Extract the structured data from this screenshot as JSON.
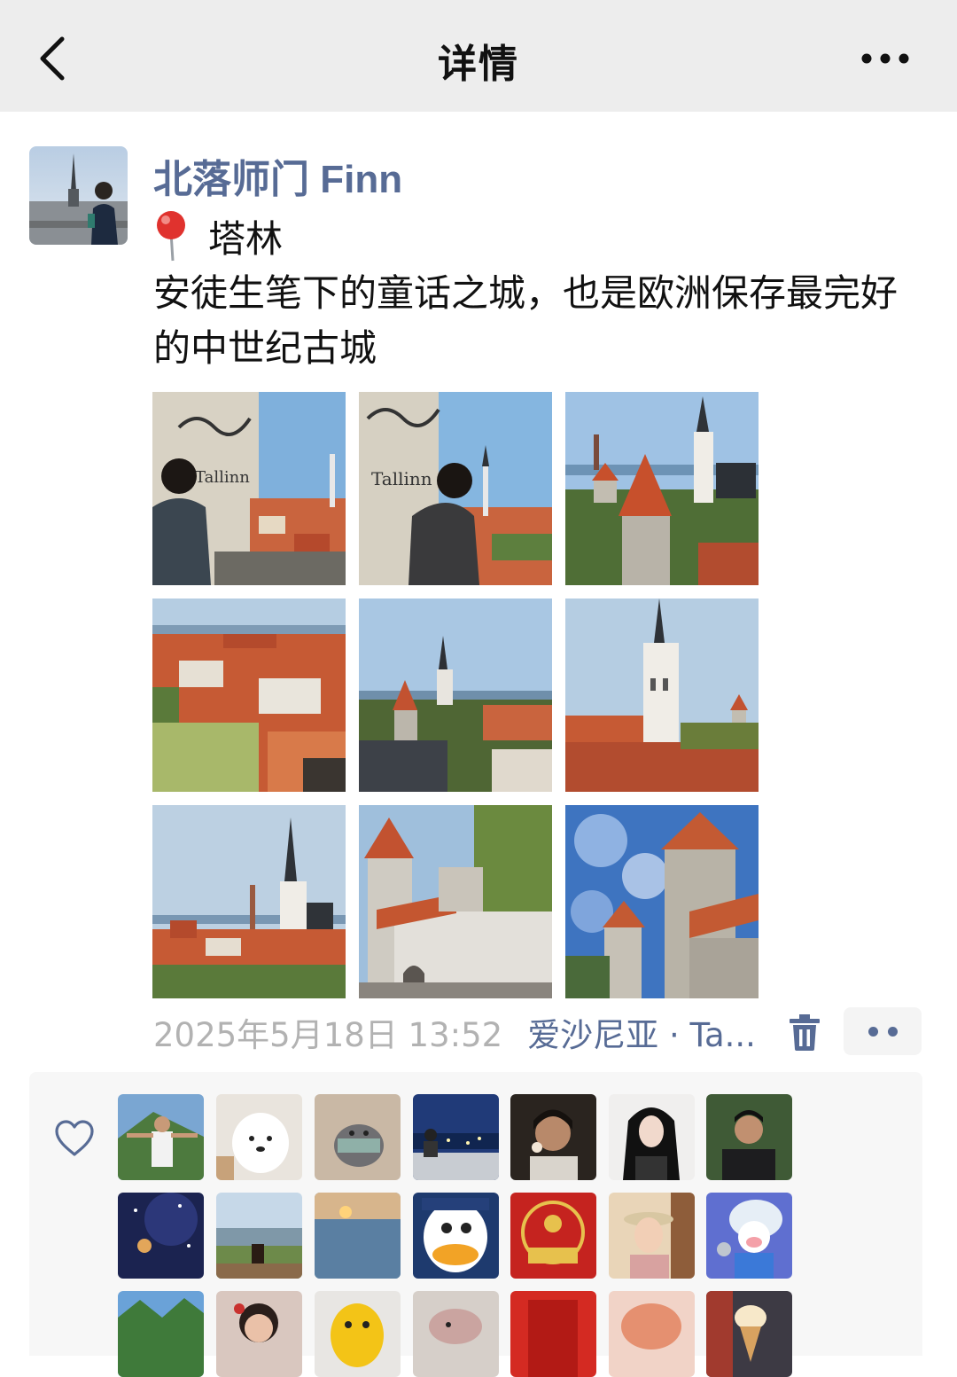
{
  "nav": {
    "title": "详情",
    "back_icon": "chevron-left-icon",
    "more_icon": "more-horizontal-icon"
  },
  "post": {
    "author": "北落师门 Finn",
    "location_icon": "map-pin-icon",
    "location": "塔林",
    "text": "安徒生笔下的童话之城，也是欧洲保存最完好的中世纪古城",
    "photo_count": 9,
    "timestamp": "2025年5月18日 13:52",
    "place": "爱沙尼亚 · Ta...",
    "delete_icon": "trash-icon",
    "comment_icon": "more-dots-icon"
  },
  "likes": {
    "icon": "heart-icon",
    "avatar_count": 21
  },
  "colors": {
    "link": "#576b95",
    "nav_bg": "#ededed",
    "timestamp": "#b2b2b2",
    "likes_bg": "#f7f7f7",
    "pin": "#e0322e"
  }
}
